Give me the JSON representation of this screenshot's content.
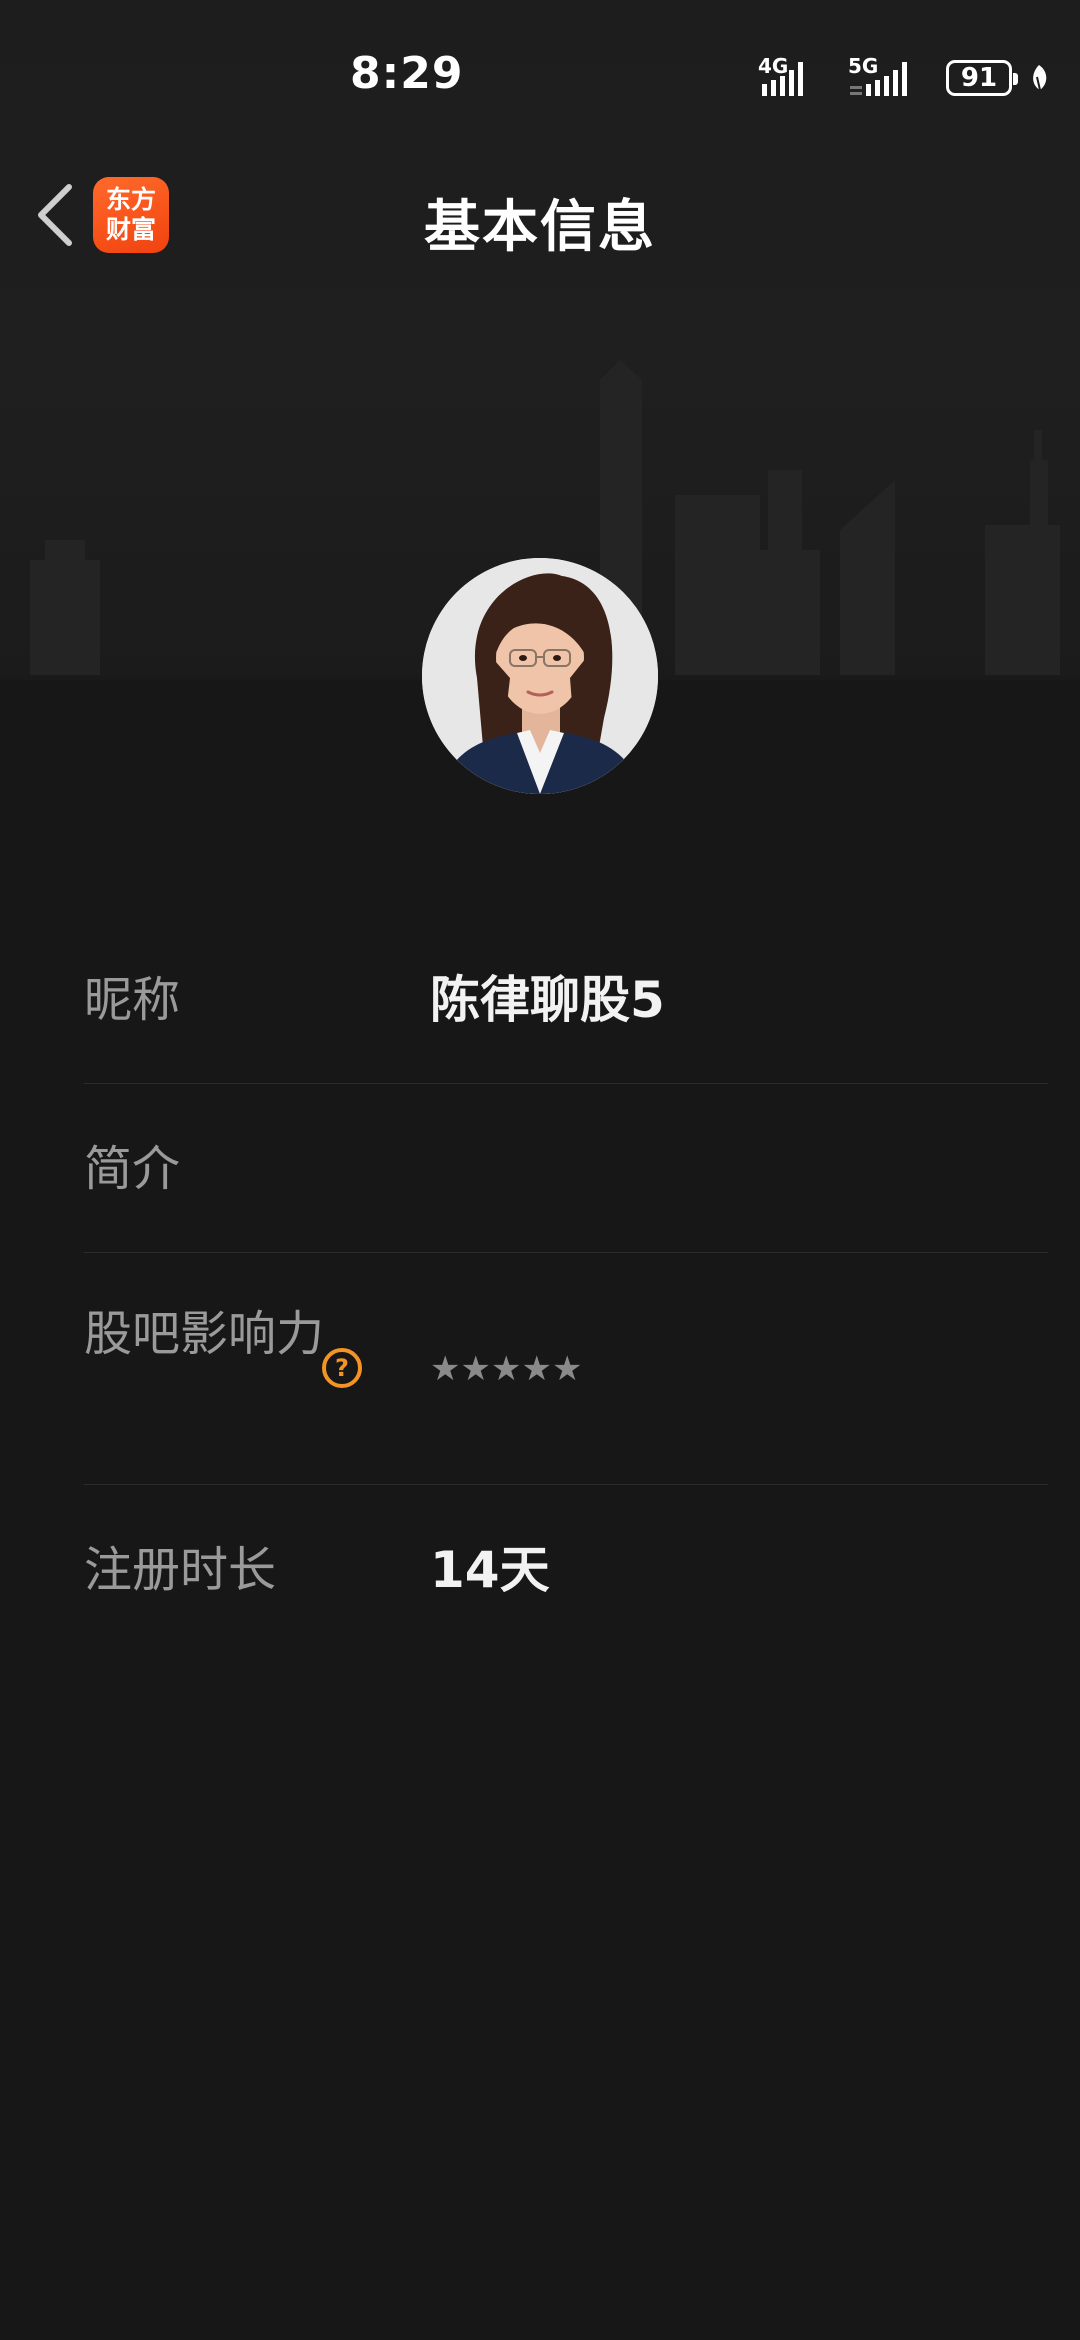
{
  "status_bar": {
    "time": "8:29",
    "network_1": "4G",
    "network_2": "5G",
    "battery": "91"
  },
  "nav": {
    "back_icon": "chevron-left-icon",
    "logo_line1": "东方",
    "logo_line2": "财富",
    "logo_color": "#f4511e",
    "title": "基本信息"
  },
  "profile": {
    "avatar": "profile-photo-woman-glasses"
  },
  "info": {
    "nickname_label": "昵称",
    "nickname_value": "陈律聊股5",
    "bio_label": "简介",
    "bio_value": "",
    "influence_label": "股吧影响力",
    "influence_help": "?",
    "influence_stars": [
      "★",
      "★",
      "★",
      "★",
      "★"
    ],
    "influence_rating": 0,
    "duration_label": "注册时长",
    "duration_value": "14天"
  },
  "colors": {
    "background": "#171717",
    "accent_orange": "#f39424",
    "label_gray": "#9a9a9a"
  }
}
